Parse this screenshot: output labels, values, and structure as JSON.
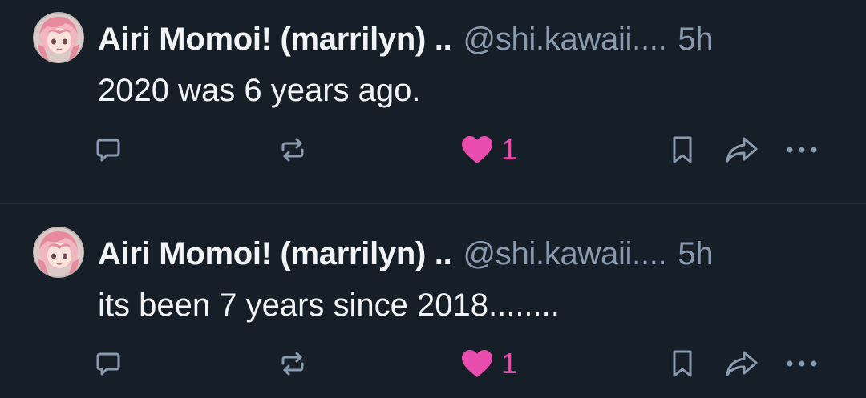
{
  "colors": {
    "background": "#161e27",
    "divider": "#232d38",
    "text_primary": "#f1f3f5",
    "text_secondary": "#8a9bb0",
    "like_pink": "#e84cad",
    "icon_gray": "#8a9bb0"
  },
  "posts": [
    {
      "author": {
        "display_name": "Airi Momoi! (marrilyn) ..",
        "handle": "@shi.kawaii....",
        "avatar_icon": "anime-girl-avatar"
      },
      "timestamp": "5h",
      "text": "2020 was 6 years ago.",
      "actions": {
        "reply_icon": "reply-bubble-icon",
        "repost_icon": "repost-arrows-icon",
        "like_icon": "heart-filled-icon",
        "like_count": "1",
        "liked": true,
        "bookmark_icon": "bookmark-icon",
        "share_icon": "share-arrow-icon",
        "more_icon": "more-dots-icon"
      }
    },
    {
      "author": {
        "display_name": "Airi Momoi! (marrilyn) ..",
        "handle": "@shi.kawaii....",
        "avatar_icon": "anime-girl-avatar"
      },
      "timestamp": "5h",
      "text": "its been 7 years since 2018........",
      "actions": {
        "reply_icon": "reply-bubble-icon",
        "repost_icon": "repost-arrows-icon",
        "like_icon": "heart-filled-icon",
        "like_count": "1",
        "liked": true,
        "bookmark_icon": "bookmark-icon",
        "share_icon": "share-arrow-icon",
        "more_icon": "more-dots-icon"
      }
    }
  ]
}
